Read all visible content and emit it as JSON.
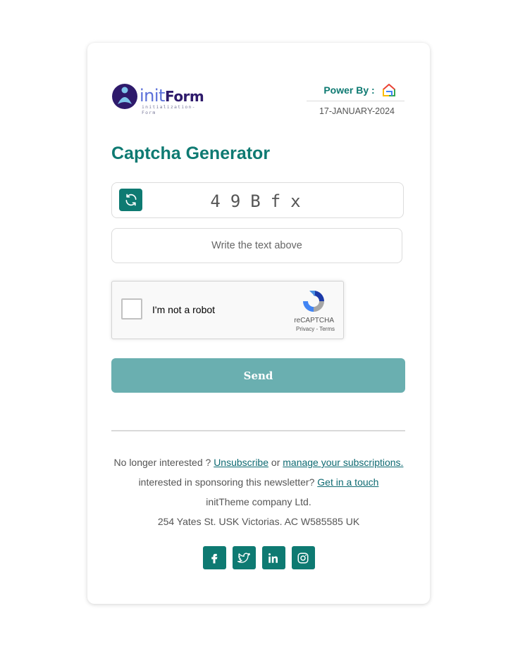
{
  "brand": {
    "logo_word_a": "init",
    "logo_word_b": "Form",
    "logo_tagline": "initialization-Form"
  },
  "header": {
    "power_by_label": "Power By :",
    "date": "17-JANUARY-2024"
  },
  "main": {
    "title": "Captcha Generator",
    "captcha_code": "49Bfx",
    "answer_placeholder": "Write the text above",
    "answer_value": "",
    "send_label": "Send"
  },
  "recaptcha": {
    "label": "I'm not a robot",
    "brand": "reCAPTCHA",
    "privacy": "Privacy",
    "separator": "-",
    "terms": "Terms",
    "checked": false
  },
  "footer": {
    "line1_prefix": "No longer interested ?",
    "unsubscribe": "Unsubscribe",
    "or": "or",
    "manage": "manage your subscriptions.",
    "line2_prefix": "interested in sponsoring this newsletter?",
    "get_in_touch": "Get in a touch",
    "company": "initTheme company Ltd.",
    "address": "254 Yates St. USK Victorias. AC W585585 UK"
  },
  "social_icons": [
    "facebook-icon",
    "twitter-icon",
    "linkedin-icon",
    "instagram-icon"
  ],
  "colors": {
    "accent": "#0e7a72",
    "send_button": "#6aafb0",
    "link": "#0e6a72",
    "logo_primary": "#2e1a6b",
    "logo_secondary": "#5a6fd8"
  }
}
